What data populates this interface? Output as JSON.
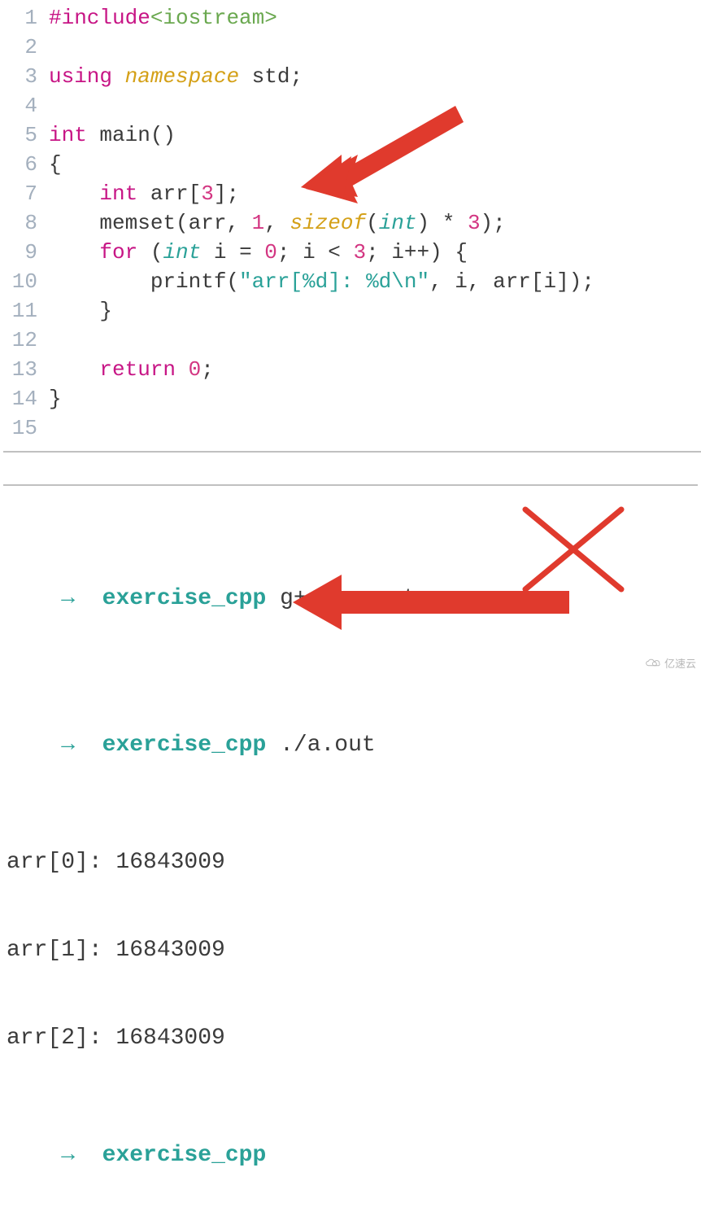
{
  "editor": {
    "lines": [
      {
        "n": "1",
        "tokens": [
          [
            "tok-pp",
            "#include"
          ],
          [
            "tok-inc",
            "<iostream>"
          ]
        ]
      },
      {
        "n": "2",
        "tokens": []
      },
      {
        "n": "3",
        "tokens": [
          [
            "tok-kw",
            "using"
          ],
          [
            "tok-plain",
            " "
          ],
          [
            "tok-ns",
            "namespace"
          ],
          [
            "tok-plain",
            " std;"
          ]
        ]
      },
      {
        "n": "4",
        "tokens": []
      },
      {
        "n": "5",
        "tokens": [
          [
            "tok-kw",
            "int"
          ],
          [
            "tok-plain",
            " main()"
          ]
        ]
      },
      {
        "n": "6",
        "tokens": [
          [
            "tok-plain",
            "{"
          ]
        ]
      },
      {
        "n": "7",
        "tokens": [
          [
            "tok-plain",
            "    "
          ],
          [
            "tok-kw",
            "int"
          ],
          [
            "tok-plain",
            " arr["
          ],
          [
            "tok-num",
            "3"
          ],
          [
            "tok-plain",
            "];"
          ]
        ]
      },
      {
        "n": "8",
        "tokens": [
          [
            "tok-plain",
            "    memset(arr, "
          ],
          [
            "tok-num",
            "1"
          ],
          [
            "tok-plain",
            ", "
          ],
          [
            "tok-sizeof",
            "sizeof"
          ],
          [
            "tok-plain",
            "("
          ],
          [
            "tok-typei",
            "int"
          ],
          [
            "tok-plain",
            ") * "
          ],
          [
            "tok-num",
            "3"
          ],
          [
            "tok-plain",
            ");"
          ]
        ]
      },
      {
        "n": "9",
        "tokens": [
          [
            "tok-plain",
            "    "
          ],
          [
            "tok-kw",
            "for"
          ],
          [
            "tok-plain",
            " ("
          ],
          [
            "tok-typei",
            "int"
          ],
          [
            "tok-plain",
            " i = "
          ],
          [
            "tok-num",
            "0"
          ],
          [
            "tok-plain",
            "; i < "
          ],
          [
            "tok-num",
            "3"
          ],
          [
            "tok-plain",
            "; i++) {"
          ]
        ]
      },
      {
        "n": "10",
        "tokens": [
          [
            "tok-plain",
            "        printf("
          ],
          [
            "tok-str",
            "\"arr[%d]: %d\\n\""
          ],
          [
            "tok-plain",
            ", i, arr[i]);"
          ]
        ]
      },
      {
        "n": "11",
        "tokens": [
          [
            "tok-plain",
            "    }"
          ]
        ]
      },
      {
        "n": "12",
        "tokens": []
      },
      {
        "n": "13",
        "tokens": [
          [
            "tok-plain",
            "    "
          ],
          [
            "tok-kw",
            "return"
          ],
          [
            "tok-plain",
            " "
          ],
          [
            "tok-num",
            "0"
          ],
          [
            "tok-plain",
            ";"
          ]
        ]
      },
      {
        "n": "14",
        "tokens": [
          [
            "tok-plain",
            "}"
          ]
        ]
      },
      {
        "n": "15",
        "tokens": []
      }
    ]
  },
  "terminal": {
    "prompt_arrow": "→",
    "prompt_dir": "exercise_cpp",
    "cmd1": "g++ memset.cpp",
    "cmd2": "./a.out",
    "out": [
      "arr[0]: 16843009",
      "arr[1]: 16843009",
      "arr[2]: 16843009"
    ]
  },
  "watermark": {
    "text": "亿速云"
  },
  "annotations": {
    "arrow1": "red-arrow-pointing-to-line-7",
    "arrow2": "red-arrow-pointing-to-output",
    "cross": "red-x-mark"
  },
  "colors": {
    "accent_arrow": "#e03a2d",
    "terminal_prompt": "#2aa198"
  }
}
